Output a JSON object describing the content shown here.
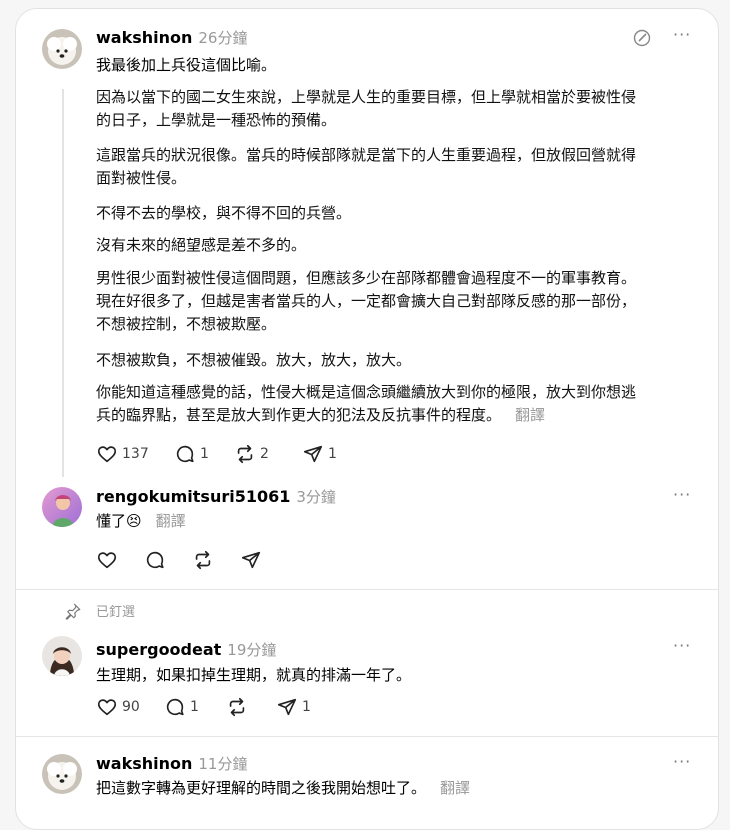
{
  "post1": {
    "username": "wakshinon",
    "time": "26分鐘",
    "intro": "我最後加上兵役這個比喻。",
    "paragraphs": [
      [
        "因為以當下的國二女生來說，上學就是人生的重要目標，但上學就相當於要被性侵",
        "的日子，上學就是一種恐怖的預備。"
      ],
      [
        "這跟當兵的狀況很像。當兵的時候部隊就是當下的人生重要過程，但放假回營就得",
        "面對被性侵。"
      ],
      [
        "不得不去的學校，與不得不回的兵營。"
      ],
      [
        "沒有未來的絕望感是差不多的。"
      ],
      [
        "男性很少面對被性侵這個問題，但應該多少在部隊都體會過程度不一的軍事教育。",
        "現在好很多了，但越是害者當兵的人，一定都會擴大自己對部隊反感的那一部份，",
        "不想被控制，不想被欺壓。"
      ],
      [
        "不想被欺負，不想被催毀。放大，放大，放大。"
      ],
      [
        "你能知道這種感覺的話，性侵大概是這個念頭繼續放大到你的極限，放大到你想逃",
        "兵的臨界點，甚至是放大到作更大的犯法及反抗事件的程度。"
      ]
    ],
    "translate": "翻譯",
    "likes": "137",
    "replies": "1",
    "reposts": "2",
    "shares": "1"
  },
  "post2": {
    "username": "rengokumitsuri51061",
    "time": "3分鐘",
    "text": "懂了😣",
    "translate": "翻譯"
  },
  "pinned_label": "已釘選",
  "post3": {
    "username": "supergoodeat",
    "time": "19分鐘",
    "text": "生理期，如果扣掉生理期，就真的排滿一年了。",
    "likes": "90",
    "replies": "1",
    "shares": "1"
  },
  "post4": {
    "username": "wakshinon",
    "time": "11分鐘",
    "text": "把這數字轉為更好理解的時間之後我開始想吐了。",
    "translate": "翻譯"
  },
  "icons": {
    "more": "more-icon",
    "like": "heart-icon",
    "reply": "comment-icon",
    "repost": "repost-icon",
    "share": "send-icon",
    "pin": "pin-icon",
    "edit": "edit-icon"
  },
  "colors": {
    "muted": "#999999",
    "thread_line": "#e3e3e3",
    "background": "#f6f6f6"
  }
}
